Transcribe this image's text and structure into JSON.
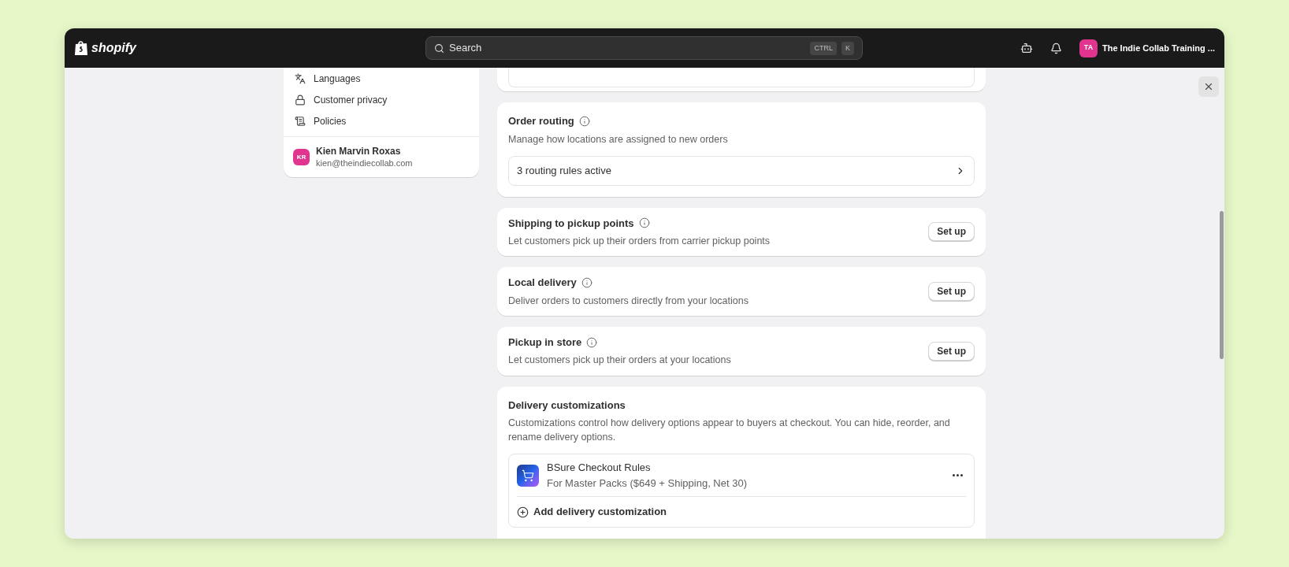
{
  "topbar": {
    "logo": "shopify",
    "search": {
      "placeholder": "Search",
      "shortcut": [
        "CTRL",
        "K"
      ]
    },
    "store": {
      "initials": "TA",
      "name": "The Indie Collab Training ..."
    }
  },
  "sidebar": {
    "items": [
      {
        "label": "Languages"
      },
      {
        "label": "Customer privacy"
      },
      {
        "label": "Policies"
      }
    ],
    "user": {
      "initials": "KR",
      "name": "Kien Marvin Roxas",
      "email": "kien@theindiecollab.com"
    }
  },
  "sections": [
    {
      "kind": "link",
      "title": "Order routing",
      "description": "Manage how locations are assigned to new orders",
      "row": "3 routing rules active"
    },
    {
      "kind": "setup",
      "title": "Shipping to pickup points",
      "description": "Let customers pick up their orders from carrier pickup points",
      "button": "Set up"
    },
    {
      "kind": "setup",
      "title": "Local delivery",
      "description": "Deliver orders to customers directly from your locations",
      "button": "Set up"
    },
    {
      "kind": "setup",
      "title": "Pickup in store",
      "description": "Let customers pick up their orders at your locations",
      "button": "Set up"
    },
    {
      "kind": "customizations",
      "title": "Delivery customizations",
      "description": "Customizations control how delivery options appear to buyers at checkout. You can hide, reorder, and rename delivery options.",
      "items": [
        {
          "name": "BSure Checkout Rules",
          "detail": "For Master Packs ($649 + Shipping, Net 30)"
        }
      ],
      "add": "Add delivery customization"
    }
  ]
}
